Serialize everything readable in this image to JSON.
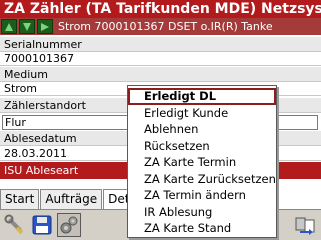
{
  "app": {
    "title": "ZA Zähler (TA Tarifkunden MDE) Netzsystem"
  },
  "record_bar": {
    "text": "Strom 7000101367 DSET o.IR(R) Tanke"
  },
  "fields": {
    "serial_label": "Serialnummer",
    "serial_value": "7000101367",
    "medium_label": "Medium",
    "medium_value": "Strom",
    "location_label": "Zählerstandort",
    "location_value": "Flur",
    "date_label": "Ablesedatum",
    "date_value": "28.03.2011",
    "reading_type_label": "ISU Ableseart"
  },
  "tabs": [
    {
      "label": "Start"
    },
    {
      "label": "Aufträge"
    },
    {
      "label": "Det"
    }
  ],
  "context_menu": {
    "items": [
      {
        "label": "Erledigt DL",
        "selected": true
      },
      {
        "label": "Erledigt Kunde"
      },
      {
        "label": "Ablehnen"
      },
      {
        "label": "Rücksetzen"
      },
      {
        "label": "ZA Karte Termin"
      },
      {
        "label": "ZA Karte Zurücksetzen"
      },
      {
        "label": "ZA Termin ändern"
      },
      {
        "label": "IR Ablesung"
      },
      {
        "label": "ZA Karte Stand"
      }
    ]
  },
  "toolbar": {
    "icons": [
      "tools-icon",
      "save-icon",
      "settings-icon",
      "transfer-icon"
    ]
  },
  "colors": {
    "title_bg": "#b31a1c",
    "record_bg": "#a43b3a",
    "nav_green": "#1b5e1b",
    "selection_border": "#8b1f1f"
  }
}
